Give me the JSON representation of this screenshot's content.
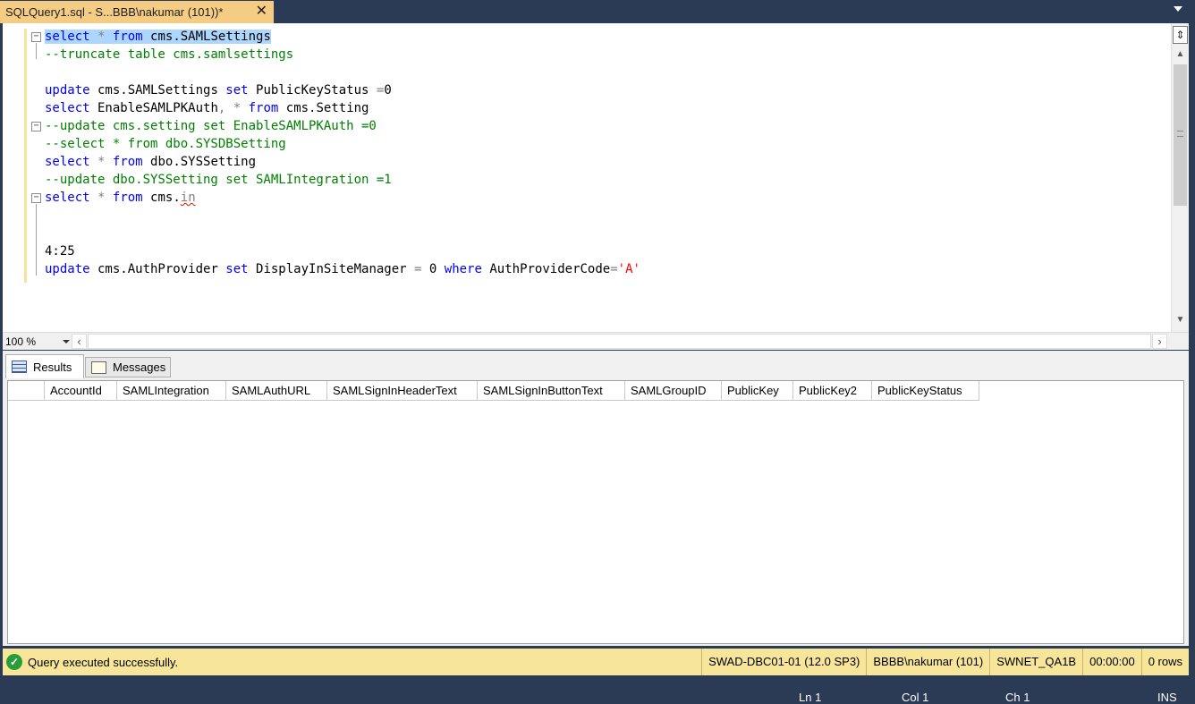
{
  "tab": {
    "title": "SQLQuery1.sql - S...BBB\\nakumar (101))*",
    "close": "✕"
  },
  "editor": {
    "lines": [
      {
        "parts": [
          {
            "t": "select",
            "c": "kw sel"
          },
          {
            "t": " ",
            "c": "sel"
          },
          {
            "t": "*",
            "c": "op sel"
          },
          {
            "t": " ",
            "c": "sel"
          },
          {
            "t": "from",
            "c": "kw sel"
          },
          {
            "t": " cms.SAMLSettings",
            "c": "sel"
          }
        ]
      },
      {
        "parts": [
          {
            "t": "--truncate table cms.samlsettings",
            "c": "cm"
          }
        ]
      },
      {
        "parts": []
      },
      {
        "parts": [
          {
            "t": "update",
            "c": "kw"
          },
          {
            "t": " cms.SAMLSettings ",
            "c": ""
          },
          {
            "t": "set",
            "c": "kw"
          },
          {
            "t": " PublicKeyStatus ",
            "c": ""
          },
          {
            "t": "=",
            "c": "op"
          },
          {
            "t": "0",
            "c": ""
          }
        ]
      },
      {
        "parts": [
          {
            "t": "select",
            "c": "kw"
          },
          {
            "t": " EnableSAMLPKAuth",
            "c": ""
          },
          {
            "t": ",",
            "c": "op"
          },
          {
            "t": " ",
            "c": ""
          },
          {
            "t": "*",
            "c": "op"
          },
          {
            "t": " ",
            "c": ""
          },
          {
            "t": "from",
            "c": "kw"
          },
          {
            "t": " cms.Setting",
            "c": ""
          }
        ]
      },
      {
        "parts": [
          {
            "t": "--update cms.setting set EnableSAMLPKAuth =0",
            "c": "cm"
          }
        ]
      },
      {
        "parts": [
          {
            "t": "--select * from dbo.SYSDBSetting",
            "c": "cm"
          }
        ]
      },
      {
        "parts": [
          {
            "t": "select",
            "c": "kw"
          },
          {
            "t": " ",
            "c": ""
          },
          {
            "t": "*",
            "c": "op"
          },
          {
            "t": " ",
            "c": ""
          },
          {
            "t": "from",
            "c": "kw"
          },
          {
            "t": " dbo.SYSSetting",
            "c": ""
          }
        ]
      },
      {
        "parts": [
          {
            "t": "--update dbo.SYSSetting set SAMLIntegration =1",
            "c": "cm"
          }
        ]
      },
      {
        "parts": [
          {
            "t": "select",
            "c": "kw"
          },
          {
            "t": " ",
            "c": ""
          },
          {
            "t": "*",
            "c": "op"
          },
          {
            "t": " ",
            "c": ""
          },
          {
            "t": "from",
            "c": "kw"
          },
          {
            "t": " cms.",
            "c": ""
          },
          {
            "t": "in",
            "c": "squig"
          }
        ]
      },
      {
        "parts": []
      },
      {
        "parts": []
      },
      {
        "parts": [
          {
            "t": "4:25",
            "c": ""
          }
        ]
      },
      {
        "parts": [
          {
            "t": "update",
            "c": "kw"
          },
          {
            "t": " cms.AuthProvider ",
            "c": ""
          },
          {
            "t": "set",
            "c": "kw"
          },
          {
            "t": " DisplayInSiteManager ",
            "c": ""
          },
          {
            "t": "=",
            "c": "op"
          },
          {
            "t": " 0 ",
            "c": ""
          },
          {
            "t": "where",
            "c": "kw"
          },
          {
            "t": " AuthProviderCode",
            "c": ""
          },
          {
            "t": "=",
            "c": "op"
          },
          {
            "t": "'A'",
            "c": "str"
          }
        ]
      }
    ]
  },
  "zoom": {
    "value": "100 %"
  },
  "results_tabs": {
    "results": "Results",
    "messages": "Messages"
  },
  "grid": {
    "columns": [
      {
        "label": "",
        "w": 41
      },
      {
        "label": "AccountId",
        "w": 81
      },
      {
        "label": "SAMLIntegration",
        "w": 122
      },
      {
        "label": "SAMLAuthURL",
        "w": 113
      },
      {
        "label": "SAMLSignInHeaderText",
        "w": 168
      },
      {
        "label": "SAMLSignInButtonText",
        "w": 165
      },
      {
        "label": "SAMLGroupID",
        "w": 108
      },
      {
        "label": "PublicKey",
        "w": 80
      },
      {
        "label": "PublicKey2",
        "w": 88
      },
      {
        "label": "PublicKeyStatus",
        "w": 120
      }
    ]
  },
  "status": {
    "message": "Query executed successfully.",
    "server": "SWAD-DBC01-01 (12.0 SP3)",
    "user": "BBBB\\nakumar (101)",
    "database": "SWNET_QA1B",
    "elapsed": "00:00:00",
    "rows": "0 rows"
  },
  "ide_status": {
    "ln": "Ln 1",
    "col": "Col 1",
    "ch": "Ch 1",
    "mode": "INS"
  }
}
